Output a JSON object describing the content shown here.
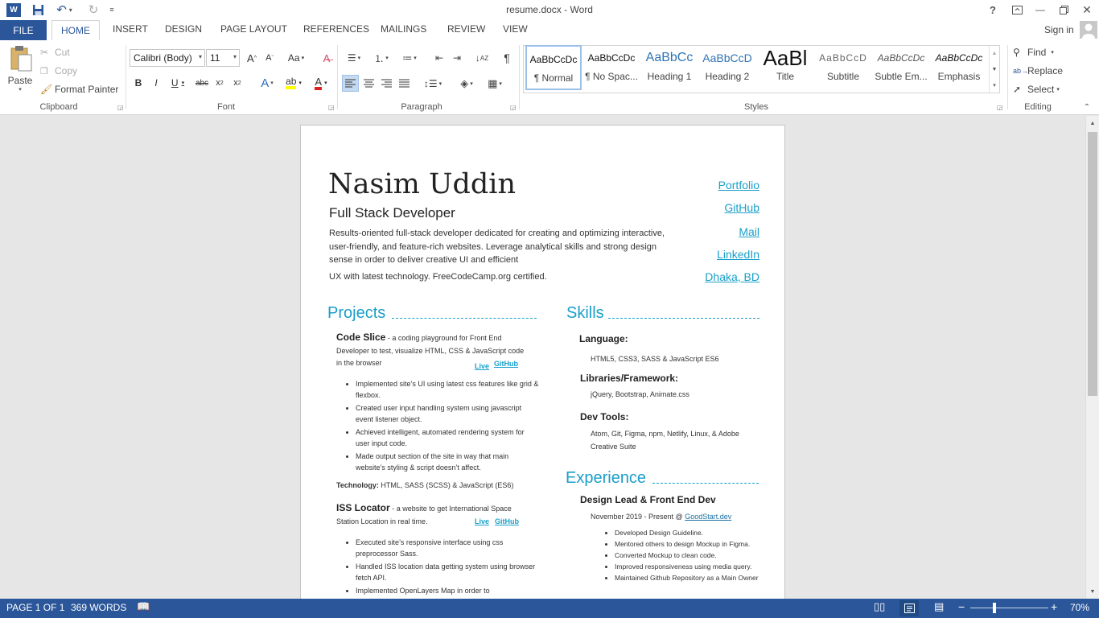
{
  "window": {
    "title": "resume.docx - Word"
  },
  "tabs": [
    "FILE",
    "HOME",
    "INSERT",
    "DESIGN",
    "PAGE LAYOUT",
    "REFERENCES",
    "MAILINGS",
    "REVIEW",
    "VIEW"
  ],
  "sign_in": "Sign in",
  "clipboard": {
    "paste": "Paste",
    "cut": "Cut",
    "copy": "Copy",
    "format_painter": "Format Painter",
    "group": "Clipboard"
  },
  "font": {
    "name": "Calibri (Body)",
    "size": "11",
    "group": "Font"
  },
  "paragraph": {
    "group": "Paragraph"
  },
  "styles": {
    "group": "Styles",
    "items": [
      {
        "preview": "AaBbCcDc",
        "label": "¶ Normal"
      },
      {
        "preview": "AaBbCcDc",
        "label": "¶ No Spac..."
      },
      {
        "preview": "AaBbCc",
        "label": "Heading 1"
      },
      {
        "preview": "AaBbCcD",
        "label": "Heading 2"
      },
      {
        "preview": "AaBl",
        "label": "Title"
      },
      {
        "preview": "AaBbCcD",
        "label": "Subtitle"
      },
      {
        "preview": "AaBbCcDc",
        "label": "Subtle Em..."
      },
      {
        "preview": "AaBbCcDc",
        "label": "Emphasis"
      }
    ]
  },
  "editing": {
    "find": "Find",
    "replace": "Replace",
    "select": "Select",
    "group": "Editing"
  },
  "doc": {
    "name": "Nasim Uddin",
    "role": "Full Stack Developer",
    "summary": "Results-oriented full-stack developer dedicated for creating and optimizing interactive, user-friendly, and feature-rich websites. Leverage analytical skills and strong design sense in order to deliver creative UI and efficient",
    "summary2": "UX with latest technology. FreeCodeCamp.org certified.",
    "links": [
      "Portfolio",
      "GitHub",
      "Mail",
      "LinkedIn",
      "Dhaka, BD"
    ],
    "projects_heading": "Projects",
    "p1_title": "Code Slice",
    "p1_dash": " - ",
    "p1_desc": "a coding playground for Front End Developer to test, visualize HTML, CSS & JavaScript code in the browser",
    "live": "Live",
    "github": "GitHub",
    "p1_bullets": [
      "Implemented site’s UI using latest css features like grid & flexbox.",
      "Created user input handling system using javascript event listener object.",
      "Achieved intelligent, automated rendering system for user input code.",
      "Made output section of the site in way that main website’s styling & script doesn’t affect."
    ],
    "tech_label": "Technology:",
    "tech_value": " HTML, SASS (SCSS) & JavaScript (ES6)",
    "p2_title": "ISS Locator",
    "p2_dash": " - ",
    "p2_desc": "a website to get International Space Station Location in real time.",
    "p2_bullets": [
      "Executed site’s responsive interface using css preprocessor Sass.",
      "Handled ISS location data getting system using browser fetch API.",
      "Implemented OpenLayers Map in order to"
    ],
    "skills_heading": "Skills",
    "lang_label": "Language:",
    "lang_value": "HTML5, CSS3, SASS & JavaScript ES6",
    "lib_label": "Libraries/Framework:",
    "lib_value": "jQuery, Bootstrap, Animate.css",
    "dev_label": "Dev Tools:",
    "dev_value": "Atom, Git, Figma, npm, Netlify, Linux, & Adobe Creative Suite",
    "exp_heading": "Experience",
    "job_title": "Design Lead & Front End Dev",
    "job_date": "November 2019 - Present @ ",
    "job_company": "GoodStart.dev",
    "job_bullets": [
      "Developed Design Guideline.",
      "Mentored others to design Mockup in Figma.",
      "Converted Mockup to clean code.",
      "Improved responsiveness using media query.",
      "Maintained Github Repository as a Main Owner"
    ]
  },
  "status": {
    "page": "PAGE 1 OF 1",
    "words": "369 WORDS",
    "zoom": "70%"
  },
  "colors": {
    "accent": "#2b579a",
    "heading": "#1a9ec9"
  }
}
